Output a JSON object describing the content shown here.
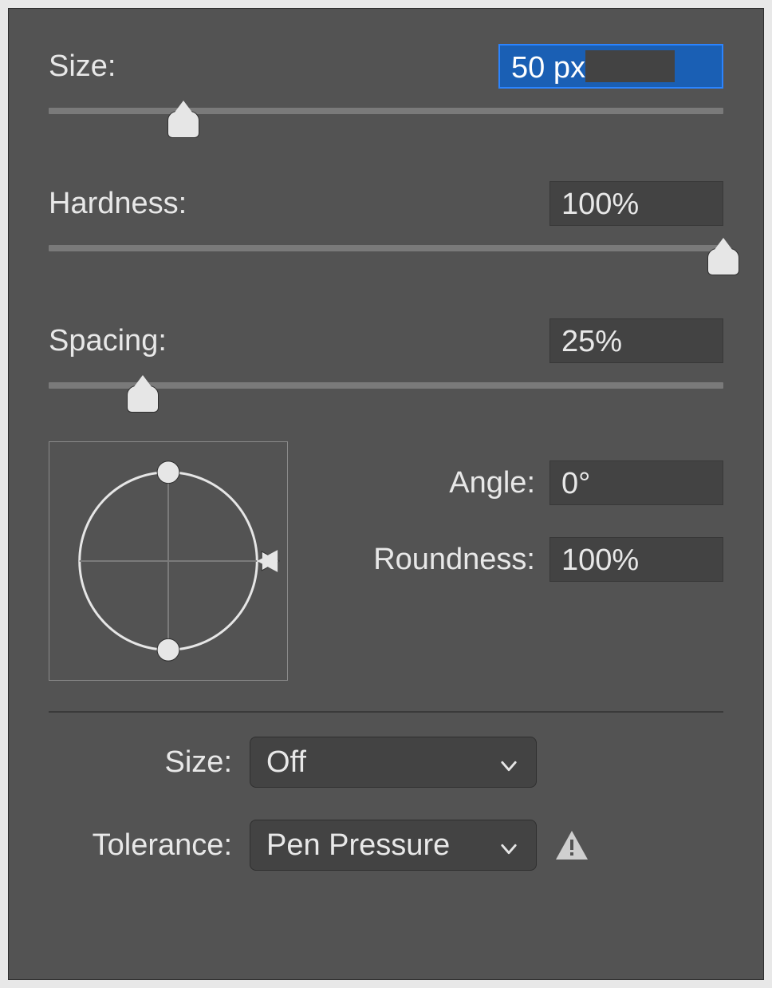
{
  "brush": {
    "size": {
      "label": "Size:",
      "value": "50 px",
      "percent": 20
    },
    "hardness": {
      "label": "Hardness:",
      "value": "100%",
      "percent": 100
    },
    "spacing": {
      "label": "Spacing:",
      "value": "25%",
      "percent": 14
    },
    "angle": {
      "label": "Angle:",
      "value": "0°"
    },
    "roundness": {
      "label": "Roundness:",
      "value": "100%"
    }
  },
  "dynamics": {
    "size": {
      "label": "Size:",
      "value": "Off"
    },
    "tolerance": {
      "label": "Tolerance:",
      "value": "Pen Pressure",
      "warning": true
    }
  }
}
